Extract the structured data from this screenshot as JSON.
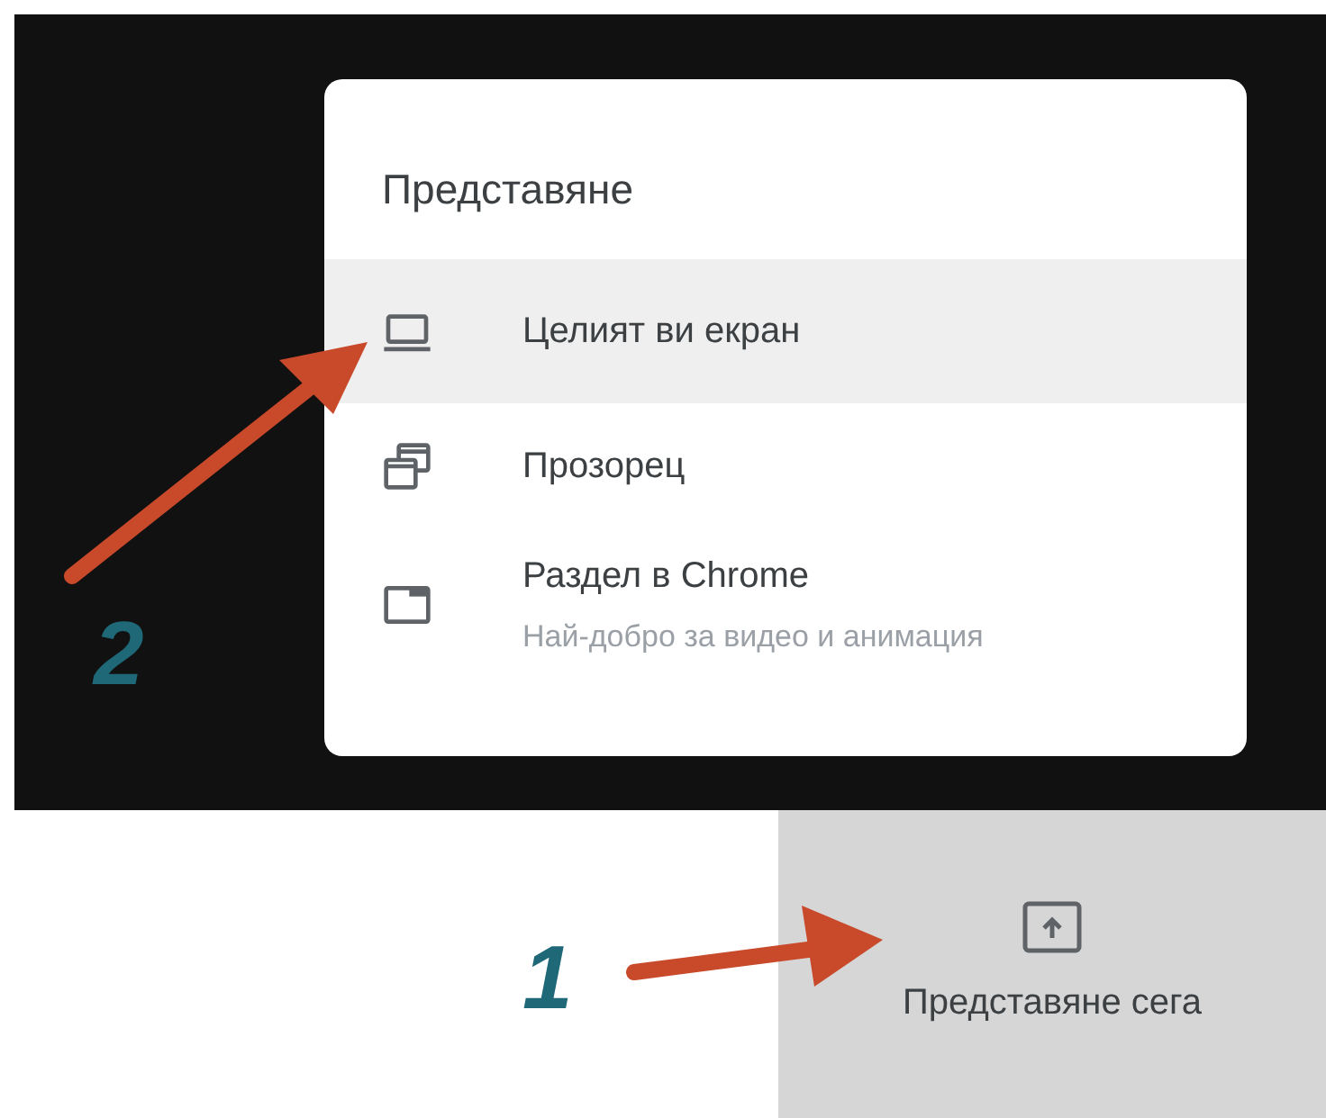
{
  "menu": {
    "title": "Представяне",
    "items": [
      {
        "kind": "screen",
        "label": "Целият ви екран",
        "selected": true
      },
      {
        "kind": "window",
        "label": "Прозорец",
        "selected": false
      },
      {
        "kind": "tab",
        "label": "Раздел в Chrome",
        "hint": "Най-добро за видео и анимация",
        "selected": false
      }
    ]
  },
  "present_button": {
    "label": "Представяне сега"
  },
  "annotations": [
    {
      "label": "2"
    },
    {
      "label": "1"
    }
  ]
}
